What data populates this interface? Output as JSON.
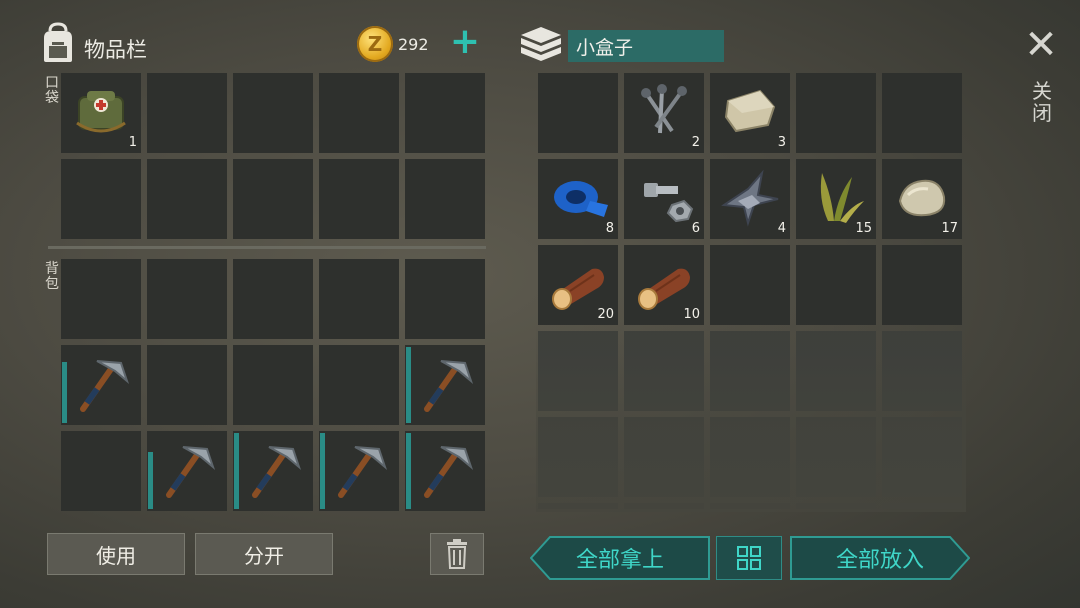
{
  "header": {
    "inventory_title": "物品栏",
    "coin_symbol": "Z",
    "coin_count": "292",
    "add_coin": "+",
    "container_name": "小盒子",
    "close_label": "关闭"
  },
  "sections": {
    "pocket_label": "口袋",
    "backpack_label": "背包"
  },
  "pocket": [
    {
      "item": "first-aid-kit",
      "count": "1"
    },
    {},
    {},
    {},
    {},
    {},
    {},
    {},
    {},
    {}
  ],
  "backpack": [
    {},
    {},
    {},
    {},
    {},
    {
      "item": "pickaxe",
      "durability": 0.8
    },
    {},
    {},
    {},
    {
      "item": "pickaxe",
      "durability": 1.0
    },
    {},
    {
      "item": "pickaxe",
      "durability": 0.75
    },
    {
      "item": "pickaxe",
      "durability": 1.0
    },
    {
      "item": "pickaxe",
      "durability": 1.0
    },
    {
      "item": "pickaxe",
      "durability": 1.0
    }
  ],
  "container": [
    {},
    {
      "item": "nails",
      "count": "2"
    },
    {
      "item": "stone-block",
      "count": "3"
    },
    {},
    {},
    {
      "item": "duct-tape",
      "count": "8"
    },
    {
      "item": "bolt-and-nut",
      "count": "6"
    },
    {
      "item": "scrap-metal",
      "count": "4"
    },
    {
      "item": "plant-fiber",
      "count": "15"
    },
    {
      "item": "stone",
      "count": "17"
    },
    {
      "item": "log",
      "count": "20"
    },
    {
      "item": "log",
      "count": "10"
    },
    {},
    {},
    {},
    {},
    {},
    {},
    {},
    {},
    {},
    {},
    {},
    {},
    {},
    {},
    {},
    {},
    {},
    {}
  ],
  "buttons": {
    "use": "使用",
    "split": "分开",
    "trash": "trash-icon",
    "take_all": "全部拿上",
    "sort": "grid-icon",
    "put_all": "全部放入"
  },
  "colors": {
    "accent": "#2ec0b0",
    "slot": "#2e302d",
    "durability": "#2a8c86"
  }
}
